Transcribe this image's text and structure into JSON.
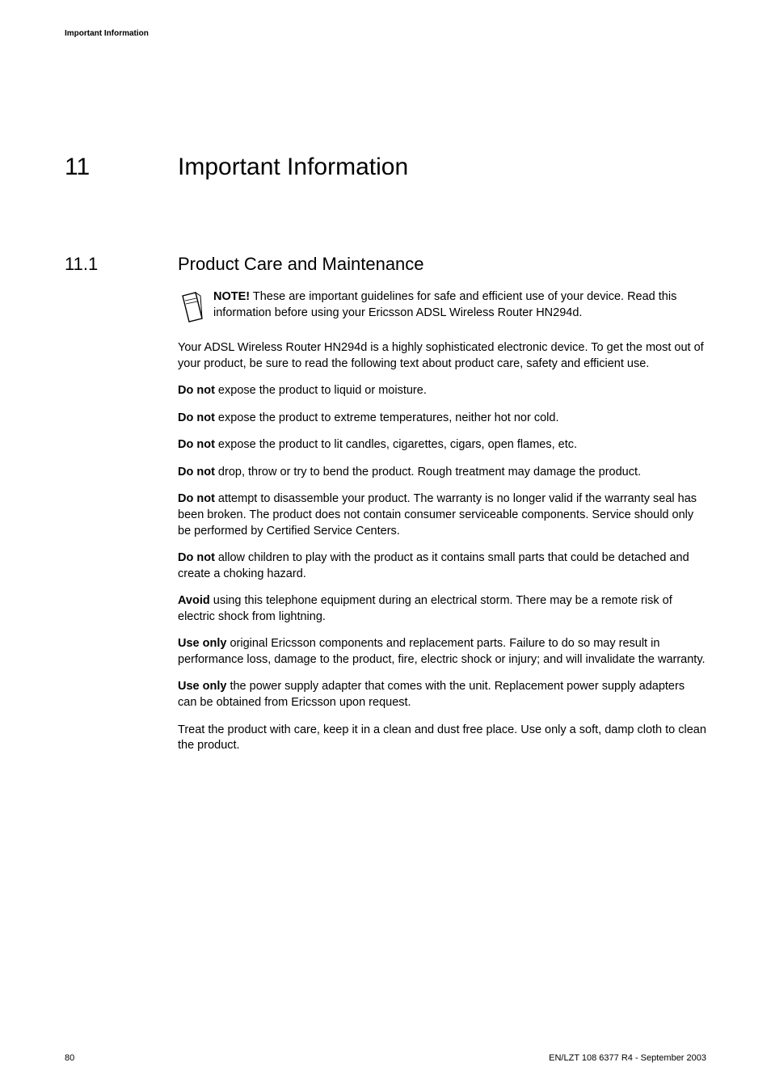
{
  "header": {
    "running": "Important Information"
  },
  "chapter": {
    "number": "11",
    "title": "Important Information"
  },
  "section": {
    "number": "11.1",
    "title": "Product Care and Maintenance"
  },
  "note": {
    "label": "NOTE!",
    "text": " These are important guidelines for safe and efficient use of your device. Read this information before using your Ericsson ADSL Wireless Router HN294d."
  },
  "paras": {
    "intro": "Your ADSL Wireless Router HN294d is a highly sophisticated electronic device. To get the most out of your product, be sure to read the following text about product care, safety and efficient use.",
    "p1_lead": "Do not",
    "p1_rest": " expose the product to liquid or moisture.",
    "p2_lead": "Do not",
    "p2_rest": " expose the product to extreme temperatures, neither hot nor cold.",
    "p3_lead": "Do not",
    "p3_rest": " expose the product to lit candles, cigarettes, cigars, open flames, etc.",
    "p4_lead": "Do not",
    "p4_rest": " drop, throw or try to bend the product. Rough treatment may damage the product.",
    "p5_lead": "Do not",
    "p5_rest": " attempt to disassemble your product. The warranty is no longer valid if the warranty seal has been broken. The product does not contain consumer serviceable components. Service should only be performed by Certified Service Centers.",
    "p6_lead": "Do not",
    "p6_rest": " allow children to play with the product as it contains small parts that could be detached and create a choking hazard.",
    "p7_lead": "Avoid",
    "p7_rest": " using this telephone equipment during an electrical storm. There may be a remote risk of electric shock from lightning.",
    "p8_lead": "Use only",
    "p8_rest": " original Ericsson components and replacement parts. Failure to do so may result in performance loss, damage to the product, fire, electric shock or injury; and will invalidate the warranty.",
    "p9_lead": "Use only",
    "p9_rest": " the power supply adapter that comes with the unit. Replacement power supply adapters can be obtained from Ericsson upon request.",
    "p10": "Treat the product with care, keep it in a clean and dust free place. Use only a soft, damp cloth to clean the product."
  },
  "footer": {
    "page": "80",
    "docid": "EN/LZT 108 6377 R4 - September 2003"
  }
}
